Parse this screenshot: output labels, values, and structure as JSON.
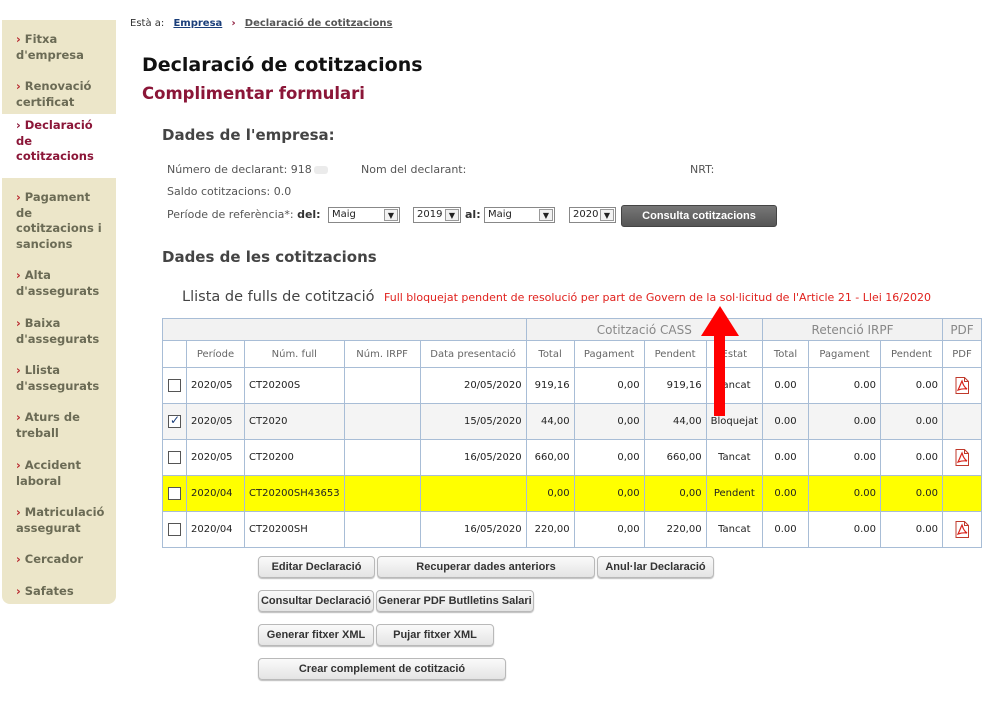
{
  "sidebar": {
    "items": [
      {
        "label": "Fitxa d'empresa",
        "active": false
      },
      {
        "label": "Renovació certificat",
        "active": false
      },
      {
        "label": "Declaració de cotitzacions",
        "active": true
      },
      {
        "label": "Pagament de cotitzacions i sancions",
        "active": false
      },
      {
        "label": "Alta d'assegurats",
        "active": false
      },
      {
        "label": "Baixa d'assegurats",
        "active": false
      },
      {
        "label": "Llista d'assegurats",
        "active": false
      },
      {
        "label": "Aturs de treball",
        "active": false
      },
      {
        "label": "Accident laboral",
        "active": false
      },
      {
        "label": "Matriculació assegurat",
        "active": false
      },
      {
        "label": "Cercador",
        "active": false
      },
      {
        "label": "Safates",
        "active": false
      }
    ]
  },
  "breadcrumb": {
    "prefix": "Està a:",
    "link": "Empresa",
    "current": "Declaració de cotitzacions"
  },
  "page": {
    "title": "Declaració de cotitzacions",
    "subtitle": "Complimentar formulari"
  },
  "empresa": {
    "heading": "Dades de l'empresa:",
    "num_declarant": "Número de declarant: 918",
    "nom_declarant": "Nom del declarant:",
    "nrt": "NRT:",
    "saldo": "Saldo cotitzacions: 0.0",
    "periode_label": "Període de referència*:",
    "del_label": "del:",
    "al_label": "al:",
    "from_month": "Maig",
    "from_year": "2019",
    "to_month": "Maig",
    "to_year": "2020",
    "consulta_button": "Consulta cotitzacions"
  },
  "cotitzacions": {
    "heading": "Dades de les cotitzacions",
    "list_title": "Llista de fulls de cotització",
    "note": "Full bloquejat pendent de resolució per part de Govern de la sol·licitud de l'Article  21 - Llei 16/2020",
    "group_headers": {
      "cass": "Cotització CASS",
      "irpf": "Retenció IRPF",
      "pdf": "PDF"
    },
    "columns": [
      "Període",
      "Núm. full",
      "Núm. IRPF",
      "Data presentació",
      "Total",
      "Pagament",
      "Pendent",
      "Estat",
      "Total",
      "Pagament",
      "Pendent",
      "PDF"
    ],
    "rows": [
      {
        "checked": false,
        "periode": "2020/05",
        "num_full": "CT20200S",
        "num_irpf": "",
        "data": "20/05/2020",
        "total": "919,16",
        "pagament": "0,00",
        "pendent": "919,16",
        "estat": "Tancat",
        "irpf_total": "0.00",
        "irpf_pagament": "0.00",
        "irpf_pendent": "0.00",
        "pdf": true,
        "style": "normal"
      },
      {
        "checked": true,
        "periode": "2020/05",
        "num_full": "CT2020",
        "num_irpf": "",
        "data": "15/05/2020",
        "total": "44,00",
        "pagament": "0,00",
        "pendent": "44,00",
        "estat": "Bloquejat",
        "irpf_total": "0.00",
        "irpf_pagament": "0.00",
        "irpf_pendent": "0.00",
        "pdf": false,
        "style": "alt"
      },
      {
        "checked": false,
        "periode": "2020/05",
        "num_full": "CT20200",
        "num_irpf": "",
        "data": "16/05/2020",
        "total": "660,00",
        "pagament": "0,00",
        "pendent": "660,00",
        "estat": "Tancat",
        "irpf_total": "0.00",
        "irpf_pagament": "0.00",
        "irpf_pendent": "0.00",
        "pdf": true,
        "style": "normal"
      },
      {
        "checked": false,
        "periode": "2020/04",
        "num_full": "CT20200SH43653",
        "num_irpf": "",
        "data": "",
        "total": "0,00",
        "pagament": "0,00",
        "pendent": "0,00",
        "estat": "Pendent",
        "irpf_total": "0.00",
        "irpf_pagament": "0.00",
        "irpf_pendent": "0.00",
        "pdf": false,
        "style": "hl"
      },
      {
        "checked": false,
        "periode": "2020/04",
        "num_full": "CT20200SH",
        "num_irpf": "",
        "data": "16/05/2020",
        "total": "220,00",
        "pagament": "0,00",
        "pendent": "220,00",
        "estat": "Tancat",
        "irpf_total": "0.00",
        "irpf_pagament": "0.00",
        "irpf_pendent": "0.00",
        "pdf": true,
        "style": "normal"
      }
    ]
  },
  "actions": {
    "editar": "Editar Declaració",
    "recuperar": "Recuperar dades anteriors",
    "anular": "Anul·lar Declaració",
    "consultar": "Consultar Declaració",
    "generar_pdf": "Generar PDF Butlletins Salari",
    "generar_xml": "Generar fitxer XML",
    "pujar_xml": "Pujar fitxer XML",
    "crear_complement": "Crear complement de cotització"
  },
  "colors": {
    "accent": "#8b1638",
    "note": "#e0201c",
    "highlight": "#ffff00",
    "sidebar": "#ece6c9"
  }
}
